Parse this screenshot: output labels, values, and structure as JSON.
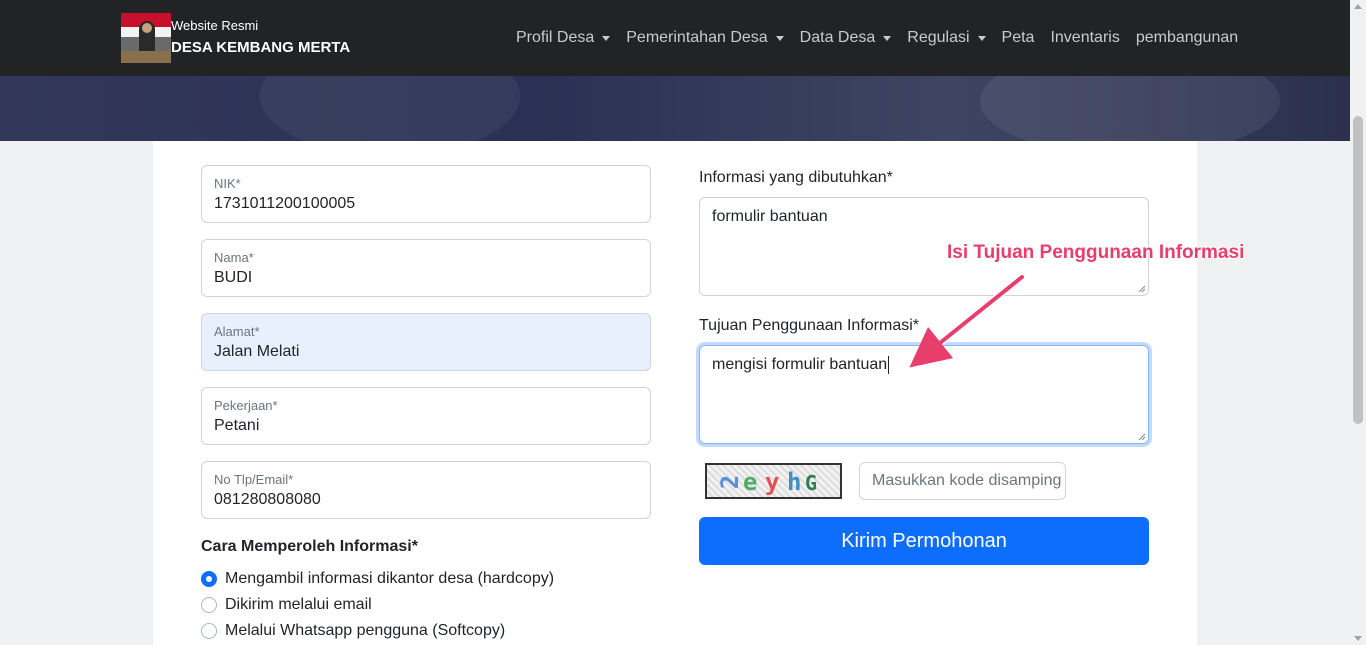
{
  "navbar": {
    "brand_small": "Website Resmi",
    "brand_title": "DESA KEMBANG MERTA",
    "logo_icon": "village-logo-icon",
    "items": [
      {
        "label": "Profil Desa",
        "dropdown": true
      },
      {
        "label": "Pemerintahan Desa",
        "dropdown": true
      },
      {
        "label": "Data Desa",
        "dropdown": true
      },
      {
        "label": "Regulasi",
        "dropdown": true
      },
      {
        "label": "Peta",
        "dropdown": false
      },
      {
        "label": "Inventaris",
        "dropdown": false
      },
      {
        "label": "pembangunan",
        "dropdown": false
      }
    ]
  },
  "form": {
    "nik": {
      "label": "NIK*",
      "value": "1731011200100005"
    },
    "nama": {
      "label": "Nama*",
      "value": "BUDI"
    },
    "alamat": {
      "label": "Alamat*",
      "value": "Jalan Melati"
    },
    "pekerjaan": {
      "label": "Pekerjaan*",
      "value": "Petani"
    },
    "kontak": {
      "label": "No Tlp/Email*",
      "value": "081280808080"
    },
    "cara": {
      "title": "Cara Memperoleh Informasi*",
      "options": [
        {
          "label": "Mengambil informasi dikantor desa (hardcopy)",
          "checked": true
        },
        {
          "label": "Dikirim melalui email",
          "checked": false
        },
        {
          "label": "Melalui Whatsapp pengguna (Softcopy)",
          "checked": false
        }
      ]
    },
    "informasi": {
      "label": "Informasi yang dibutuhkan*",
      "value": "formulir bantuan"
    },
    "tujuan": {
      "label": "Tujuan Penggunaan Informasi*",
      "value": "mengisi formulir bantuan"
    },
    "captcha": {
      "code": "2eyhG",
      "placeholder": "Masukkan kode disamping"
    },
    "submit_label": "Kirim Permohonan"
  },
  "annotation": {
    "text": "Isi Tujuan Penggunaan Informasi",
    "color": "#e83e6c"
  },
  "colors": {
    "navbar": "#222325",
    "primary": "#0d6efd"
  }
}
